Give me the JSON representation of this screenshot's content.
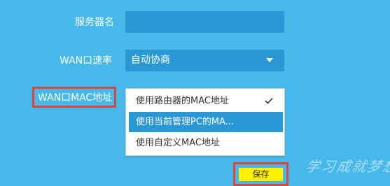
{
  "form": {
    "server_name_label": "服务器名",
    "server_name_value": "",
    "wan_speed_label": "WAN口速率",
    "wan_speed_value": "自动协商",
    "wan_mac_label": "WAN口MAC地址"
  },
  "mac_dropdown": {
    "options": [
      {
        "label": "使用路由器的MAC地址",
        "checked": true
      },
      {
        "label": "使用当前管理PC的MA...",
        "highlighted": true
      },
      {
        "label": "使用自定义MAC地址"
      }
    ]
  },
  "actions": {
    "save_label": "保存"
  },
  "watermark": {
    "text": "学习成就梦想"
  },
  "colors": {
    "background": "#46b9ea",
    "field": "#2b98d6",
    "highlight": "#2b98d6",
    "save_button": "#ffef00",
    "annotation_outline": "#e0453a"
  },
  "icons": {
    "selected_option": "check-icon",
    "select_arrow": "caret-down-icon"
  }
}
